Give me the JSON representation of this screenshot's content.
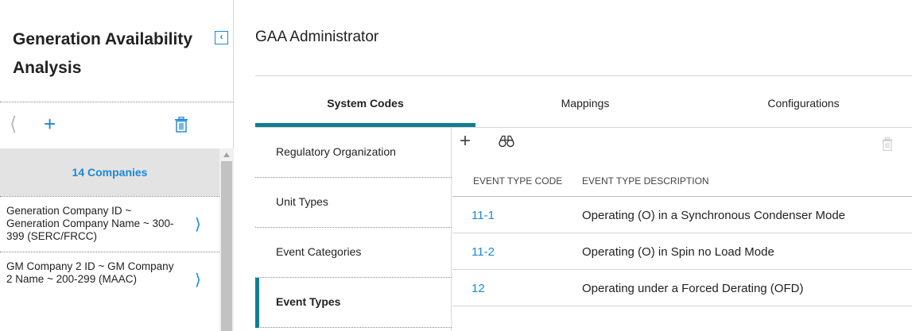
{
  "left_panel": {
    "title": "Generation Availability Analysis",
    "collapse_icon": "chevron-left-icon",
    "toolbar": {
      "back_icon": "chevron-left-icon",
      "add_icon": "plus-icon",
      "delete_icon": "trash-icon"
    },
    "companies_label": "14 Companies",
    "items": [
      {
        "label": "Generation Company ID ~ Generation Company Name ~ 300-399 (SERC/FRCC)"
      },
      {
        "label": "GM Company 2 ID ~ GM Company 2 Name ~ 200-299 (MAAC)"
      }
    ]
  },
  "main": {
    "title": "GAA Administrator",
    "tabs": [
      {
        "label": "System Codes",
        "active": true
      },
      {
        "label": "Mappings",
        "active": false
      },
      {
        "label": "Configurations",
        "active": false
      }
    ],
    "subnav": [
      {
        "label": "Regulatory Organization",
        "active": false
      },
      {
        "label": "Unit Types",
        "active": false
      },
      {
        "label": "Event Categories",
        "active": false
      },
      {
        "label": "Event Types",
        "active": true
      }
    ],
    "toolbar": {
      "add_icon": "plus-icon",
      "find_icon": "binoculars-icon",
      "delete_icon": "trash-icon"
    },
    "table": {
      "columns": [
        "EVENT TYPE CODE",
        "EVENT TYPE DESCRIPTION"
      ],
      "rows": [
        {
          "code": "11-1",
          "description": "Operating (O) in a Synchronous Condenser Mode"
        },
        {
          "code": "11-2",
          "description": "Operating (O) in Spin no Load Mode"
        },
        {
          "code": "12",
          "description": "Operating under a Forced Derating (OFD)"
        }
      ]
    }
  },
  "colors": {
    "accent": "#1a87d8",
    "tab_indicator": "#0f7f92",
    "selected_bg": "#e3e3e3"
  }
}
